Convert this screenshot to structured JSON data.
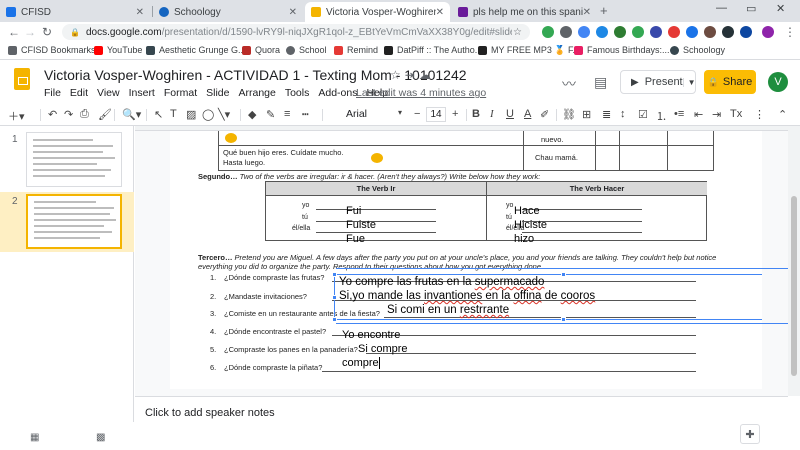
{
  "browser": {
    "tabs": [
      {
        "label": "CFISD",
        "color": "#1a73e8",
        "active": false
      },
      {
        "label": "Schoology",
        "color": "#1565c0",
        "active": false
      },
      {
        "label": "Victoria Vosper-Woghiren - ACTIV",
        "color": "#f4b400",
        "active": true
      },
      {
        "label": "pls help me on this spanish last",
        "color": "#6a1b9a",
        "active": false
      }
    ],
    "new_tab_glyph": "+",
    "address": {
      "domain": "docs.google.com",
      "path": "/presentation/d/1590-lvRY9l-niqJXgR1qol-z_EBtYeVmCmVaXX38Y0g/edit#slide=id...."
    },
    "bookmarks": [
      {
        "label": "CFISD Bookmarks",
        "color": "#5f6368"
      },
      {
        "label": "YouTube",
        "color": "#ff0000"
      },
      {
        "label": "Aesthetic Grunge G...",
        "color": "#37474f"
      },
      {
        "label": "Quora",
        "color": "#b92b27"
      },
      {
        "label": "School",
        "color": "#5f6368"
      },
      {
        "label": "Remind",
        "color": "#e53935"
      },
      {
        "label": "DatPiff :: The Autho...",
        "color": "#212121"
      },
      {
        "label": "MY FREE MP3 🏅 F...",
        "color": "#212121"
      },
      {
        "label": "Famous Birthdays:...",
        "color": "#e91e63"
      },
      {
        "label": "Schoology",
        "color": "#37474f"
      }
    ]
  },
  "app": {
    "title": "Victoria Vosper-Woghiren - ACTIVIDAD  1 - Texting Mom - 10101242",
    "menus": [
      "File",
      "Edit",
      "View",
      "Insert",
      "Format",
      "Slide",
      "Arrange",
      "Tools",
      "Add-ons",
      "Help"
    ],
    "last_edit": "Last edit was 4 minutes ago",
    "present_label": "Present",
    "share_label": "Share",
    "avatar_letter": "V",
    "brand_color": "#f4b400",
    "share_color": "#fbbc04"
  },
  "toolbar": {
    "font": "Arial",
    "font_size": "14"
  },
  "filmstrip": {
    "slides": [
      {
        "num": "1"
      },
      {
        "num": "2",
        "selected": true
      }
    ]
  },
  "slide": {
    "top_table": {
      "row1_left": "Qué buen hijo eres.  Cuídate mucho.",
      "row1_left2": "Hasta luego.",
      "top_right_a": "nuevo.",
      "row2_right": "Chau mamá."
    },
    "segundo": {
      "label": "Segundo…",
      "text": " Two of the verbs are irregular: ir & hacer.  (Aren't they always?)  Write below how they work:"
    },
    "verb_table": {
      "left_header": "The Verb Ir",
      "right_header": "The Verb Hacer",
      "pronouns": [
        "yo",
        "tú",
        "él/ella"
      ],
      "ir_answers": [
        "Fui",
        "Fuiste",
        "Fue"
      ],
      "hacer_answers": [
        "Hace",
        "Hiciste",
        "hizo"
      ]
    },
    "tercero": {
      "label": "Tercero…",
      "line1": " Pretend you are Miguel.  A few days after the party you put on at your uncle's place, you and your friends are talking.  They couldn't help but notice",
      "line2": "everything you did to organize the party.  Respond to their questions about how you got everything done."
    },
    "questions": [
      {
        "n": "1.",
        "q": "¿Dónde compraste las frutas?"
      },
      {
        "n": "2.",
        "q": "¿Mandaste invitaciones?"
      },
      {
        "n": "3.",
        "q": "¿Comiste en un restaurante antes de la fiesta?"
      },
      {
        "n": "4.",
        "q": "¿Dónde encontraste el pastel?"
      },
      {
        "n": "5.",
        "q": "¿Compraste los panes en la panadería?"
      },
      {
        "n": "6.",
        "q": "¿Dónde compraste la piñata?"
      }
    ],
    "typed_box": {
      "line1": "Yo compre las frutas en la ",
      "line1_err": "supermacado",
      "line2": "Si,yo mande las  ",
      "line2_err1": "invantiones",
      "line2_mid": "  en la  ",
      "line2_err2": "offina",
      "line2_end": " de ",
      "line2_err3": "cooros",
      "line3": "Si comi en un ",
      "line3_err": "restrrante"
    },
    "loose_answers": [
      "Yo  encontre",
      "Si compre",
      "compre"
    ]
  },
  "notes": {
    "placeholder": "Click to add speaker notes"
  }
}
